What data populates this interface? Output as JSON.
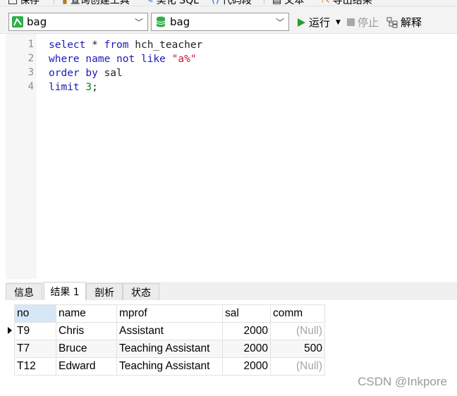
{
  "toolbar": {
    "items": [
      "保存",
      "查询创建工具",
      "美化 SQL",
      "代码段",
      "文本",
      "导出结果"
    ]
  },
  "selectors": {
    "connection": "bag",
    "database": "bag"
  },
  "actions": {
    "run": "运行",
    "stop": "停止",
    "explain": "解释"
  },
  "editor": {
    "line_numbers": [
      "1",
      "2",
      "3",
      "4"
    ],
    "lines": [
      [
        {
          "t": "select",
          "c": "kw"
        },
        {
          "t": " * ",
          "c": "plain"
        },
        {
          "t": "from",
          "c": "kw"
        },
        {
          "t": " hch_teacher",
          "c": "plain"
        }
      ],
      [
        {
          "t": "where",
          "c": "kw"
        },
        {
          "t": " name ",
          "c": "kw"
        },
        {
          "t": "not like",
          "c": "kw"
        },
        {
          "t": " ",
          "c": "plain"
        },
        {
          "t": "\"a%\"",
          "c": "str"
        }
      ],
      [
        {
          "t": "order by",
          "c": "kw"
        },
        {
          "t": " sal",
          "c": "plain"
        }
      ],
      [
        {
          "t": "limit",
          "c": "kw"
        },
        {
          "t": " ",
          "c": "plain"
        },
        {
          "t": "3",
          "c": "num"
        },
        {
          "t": ";",
          "c": "plain"
        }
      ]
    ]
  },
  "panel": {
    "tabs": [
      "信息",
      "结果 1",
      "剖析",
      "状态"
    ],
    "active_tab": "结果 1"
  },
  "result": {
    "columns": [
      "no",
      "name",
      "mprof",
      "sal",
      "comm"
    ],
    "rows": [
      [
        "T9",
        "Chris",
        "Assistant",
        "2000",
        "(Null)"
      ],
      [
        "T7",
        "Bruce",
        "Teaching Assistant",
        "2000",
        "500"
      ],
      [
        "T12",
        "Edward",
        "Teaching Assistant",
        "2000",
        "(Null)"
      ]
    ]
  },
  "watermark": "CSDN @Inkpore",
  "colors": {
    "keyword": "#1a1ab8",
    "string": "#d0103a",
    "number": "#0a8a0a",
    "run_green": "#22a32a",
    "null_gray": "#a6a6a6"
  }
}
